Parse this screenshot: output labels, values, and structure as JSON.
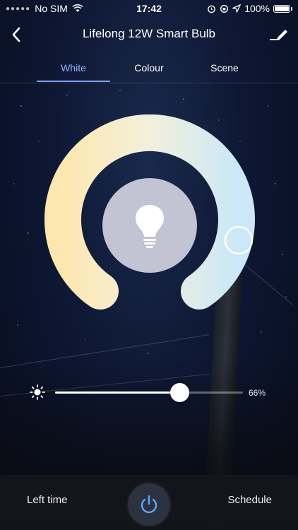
{
  "status_bar": {
    "carrier": "No SIM",
    "time": "17:42",
    "battery": "100%"
  },
  "header": {
    "title": "Lifelong 12W Smart Bulb",
    "back_icon": "chevron-left-icon",
    "edit_icon": "edit-pen-icon"
  },
  "tabs": [
    {
      "label": "White",
      "active": true
    },
    {
      "label": "Colour",
      "active": false
    },
    {
      "label": "Scene",
      "active": false
    }
  ],
  "color_temperature": {
    "warm_color": "#fde7b0",
    "cool_color": "#cbe7f8",
    "selected_fraction": 0.95
  },
  "brightness": {
    "value_label": "66%",
    "value": 66
  },
  "bottom_bar": {
    "left_label": "Left time",
    "right_label": "Schedule",
    "power_icon": "power-icon"
  },
  "colors": {
    "accent": "#7aa3ff",
    "power_icon": "#5aa6ff"
  }
}
